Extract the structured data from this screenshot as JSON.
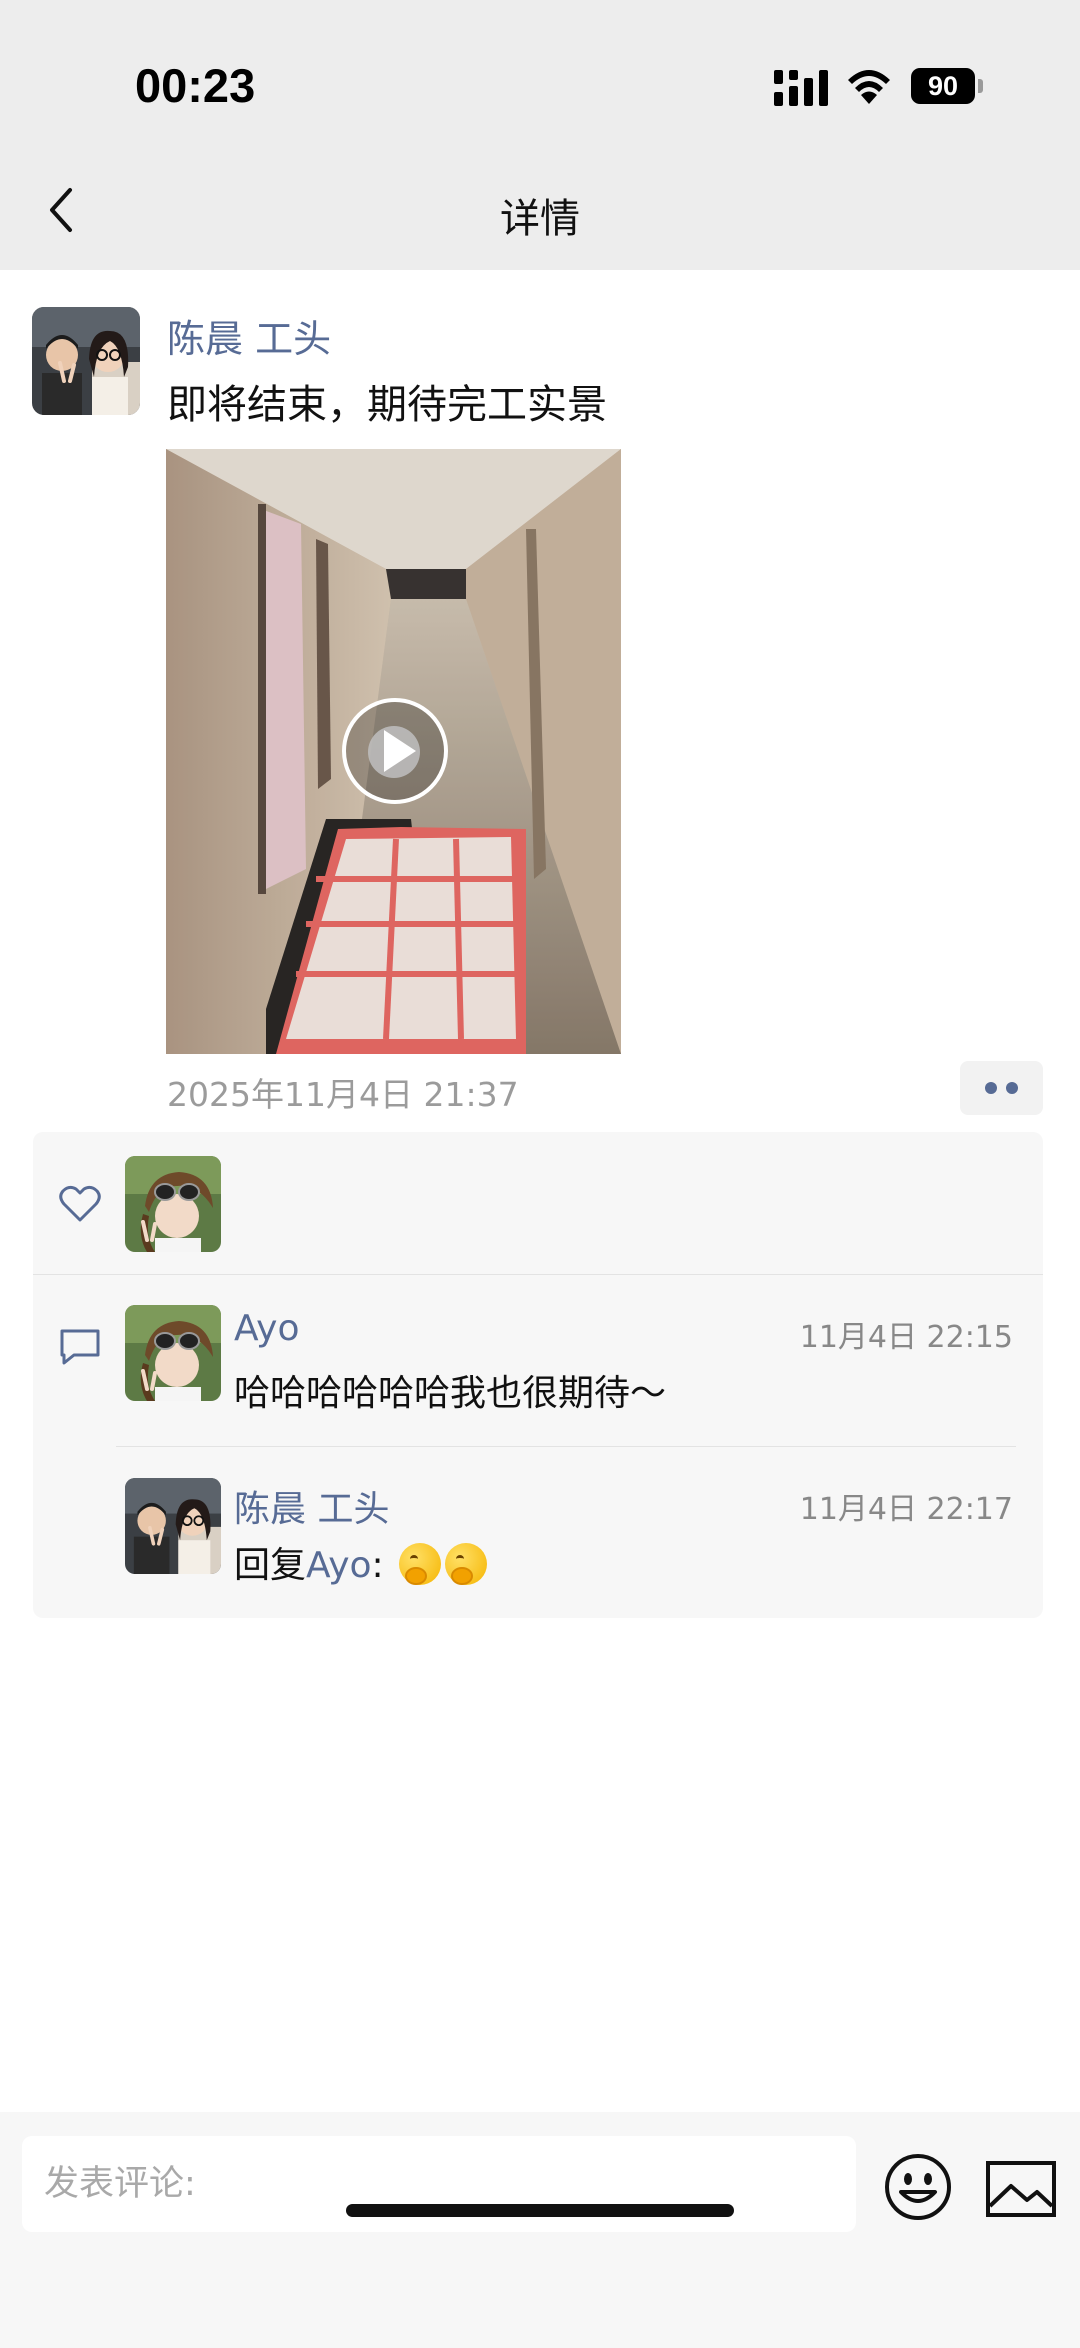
{
  "status_bar": {
    "time": "00:23",
    "battery": "90"
  },
  "nav": {
    "title": "详情"
  },
  "post": {
    "author": "陈晨 工头",
    "text": "即将结束，期待完工实景",
    "timestamp": "2025年11月4日 21:37"
  },
  "comments": [
    {
      "author": "Ayo",
      "time": "11月4日 22:15",
      "text": "哈哈哈哈哈哈我也很期待～"
    },
    {
      "author": "陈晨 工头",
      "time": "11月4日 22:17",
      "reply_prefix": "回复",
      "reply_to": "Ayo",
      "separator": ":"
    }
  ],
  "composer": {
    "placeholder": "发表评论:"
  },
  "icons": {
    "back": "chevron-left-icon",
    "play": "play-icon",
    "more": "more-dots-icon",
    "like": "heart-icon",
    "comment": "comment-icon",
    "emoji": "smiley-icon",
    "image": "image-icon"
  },
  "colors": {
    "link_blue": "#576b95",
    "secondary_gray": "#9b9b9b",
    "nav_bg": "#ededed"
  }
}
